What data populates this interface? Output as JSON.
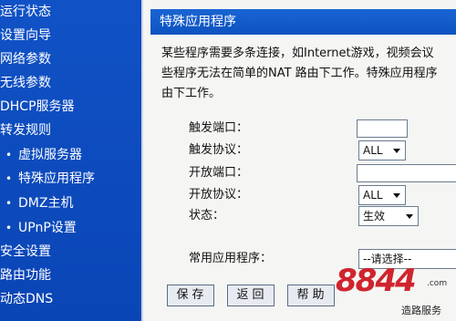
{
  "sidebar": {
    "items": [
      {
        "label": "运行状态",
        "sub": false
      },
      {
        "label": "设置向导",
        "sub": false
      },
      {
        "label": "网络参数",
        "sub": false
      },
      {
        "label": "无线参数",
        "sub": false
      },
      {
        "label": "DHCP服务器",
        "sub": false
      },
      {
        "label": "转发规则",
        "sub": false
      },
      {
        "label": "虚拟服务器",
        "sub": true
      },
      {
        "label": "特殊应用程序",
        "sub": true
      },
      {
        "label": "DMZ主机",
        "sub": true
      },
      {
        "label": "UPnP设置",
        "sub": true
      },
      {
        "label": "安全设置",
        "sub": false
      },
      {
        "label": "路由功能",
        "sub": false
      },
      {
        "label": "动态DNS",
        "sub": false
      }
    ],
    "bullet": "•"
  },
  "panel": {
    "title": "特殊应用程序",
    "description": [
      "某些程序需要多条连接，如Internet游戏，视频会议",
      "些程序无法在简单的NAT 路由下工作。特殊应用程序",
      "由下工作。"
    ],
    "form": {
      "trigger_port_label": "触发端口：",
      "trigger_port_value": "",
      "trigger_protocol_label": "触发协议：",
      "trigger_protocol_value": "ALL",
      "open_port_label": "开放端口：",
      "open_port_value": "",
      "open_protocol_label": "开放协议：",
      "open_protocol_value": "ALL",
      "status_label": "状态：",
      "status_value": "生效",
      "common_apps_label": "常用应用程序：",
      "common_apps_value": "--请选择--"
    },
    "buttons": {
      "save": "保存",
      "back": "返回",
      "help": "帮助"
    }
  },
  "watermark": {
    "logo": "8844",
    "com": ".com",
    "text": "造路服务"
  },
  "colors": {
    "sidebar_bg": "#0c4bbf",
    "title_bar": "#1565d4",
    "panel_bg": "#f5f6f4",
    "logo_red": "#d0242e"
  }
}
